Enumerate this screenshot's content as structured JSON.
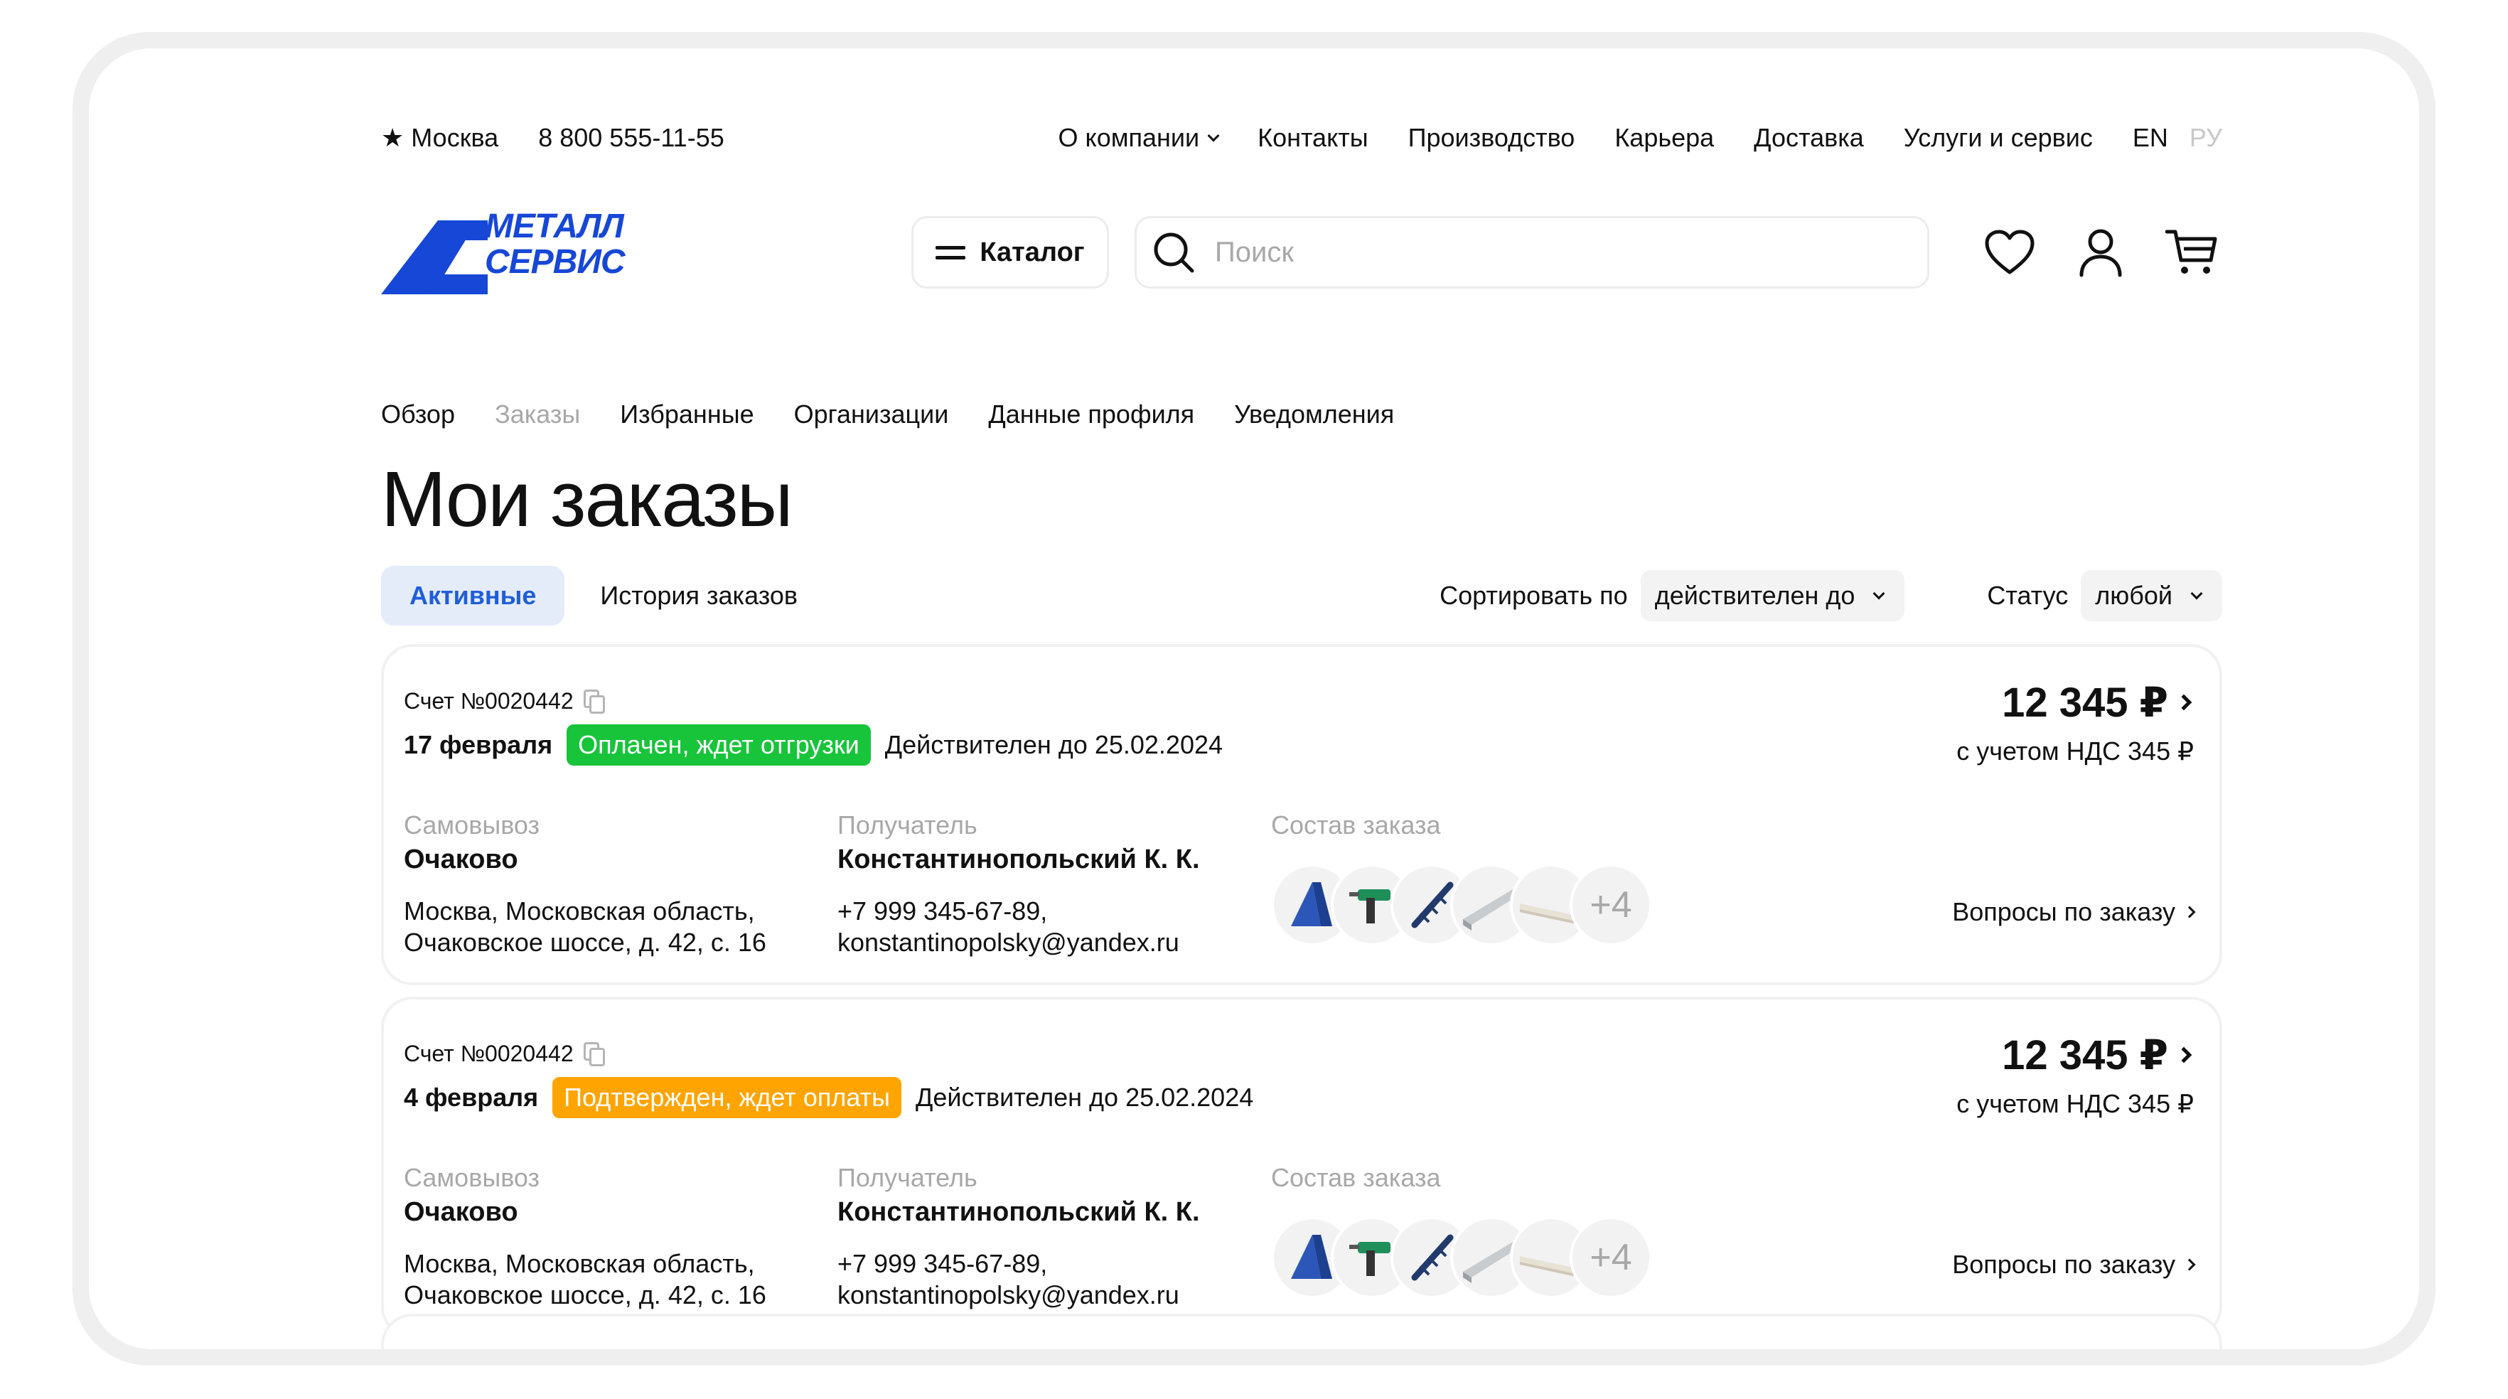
{
  "topbar": {
    "city": "Москва",
    "phone": "8 800 555-11-55",
    "nav": [
      "О компании",
      "Контакты",
      "Производство",
      "Карьера",
      "Доставка",
      "Услуги и сервис"
    ],
    "lang_en": "EN",
    "lang_ru": "РУ"
  },
  "header": {
    "logo_line1": "МЕТАЛЛ",
    "logo_line2": "СЕРВИС",
    "catalog_label": "Каталог",
    "search_placeholder": "Поиск"
  },
  "profile_nav": [
    "Обзор",
    "Заказы",
    "Избранные",
    "Организации",
    "Данные профиля",
    "Уведомления"
  ],
  "page_title": "Мои заказы",
  "filters": {
    "tab_active": "Активные",
    "tab_history": "История заказов",
    "sort_label": "Сортировать по",
    "sort_value": "действителен до",
    "status_label": "Статус",
    "status_value": "любой"
  },
  "colors": {
    "brand": "#1747d6",
    "accent": "#1f5ed8",
    "status_paid": "#17c43a",
    "status_confirmed": "#ffa400"
  },
  "orders": [
    {
      "invoice": "Счет №0020442",
      "date": "17 февраля",
      "status": "Оплачен, ждет отгрузки",
      "valid_until": "Действителен до 25.02.2024",
      "price": "12 345 ₽",
      "vat": "с учетом НДС 345 ₽",
      "pickup_label": "Самовывоз",
      "pickup_point": "Очаково",
      "address_line1": "Москва, Московская область,",
      "address_line2": "Очаковское шоссе, д. 42, с. 16",
      "recipient_label": "Получатель",
      "recipient_name": "Константинопольский К. К.",
      "recipient_phone": "+7 999 345-67-89,",
      "recipient_email": "konstantinopolsky@yandex.ru",
      "items_label": "Состав заказа",
      "more_items": "+4",
      "questions": "Вопросы по заказу"
    },
    {
      "invoice": "Счет №0020442",
      "date": "4 февраля",
      "status": "Подтвержден, ждет оплаты",
      "valid_until": "Действителен до 25.02.2024",
      "price": "12 345 ₽",
      "vat": "с учетом НДС 345 ₽",
      "pickup_label": "Самовывоз",
      "pickup_point": "Очаково",
      "address_line1": "Москва, Московская область,",
      "address_line2": "Очаковское шоссе, д. 42, с. 16",
      "recipient_label": "Получатель",
      "recipient_name": "Константинопольский К. К.",
      "recipient_phone": "+7 999 345-67-89,",
      "recipient_email": "konstantinopolsky@yandex.ru",
      "items_label": "Состав заказа",
      "more_items": "+4",
      "questions": "Вопросы по заказу"
    }
  ]
}
